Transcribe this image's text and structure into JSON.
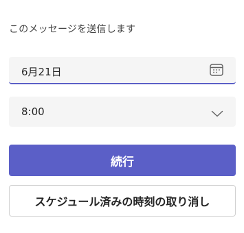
{
  "schedule_panel": {
    "heading": "このメッセージを送信します",
    "date": {
      "value": "6月21日",
      "icon": "calendar-icon"
    },
    "time": {
      "value": "8:00",
      "icon": "chevron-down-icon"
    },
    "continue_label": "続行",
    "cancel_label": "スケジュール済みの時刻の取り消し"
  },
  "colors": {
    "accent": "#5b5fc7",
    "field_background": "#f5f5f5",
    "text": "#242424"
  }
}
